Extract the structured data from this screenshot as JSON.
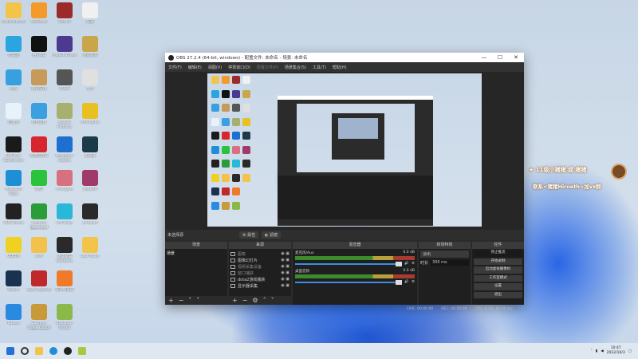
{
  "desktop_icons": [
    {
      "label": "Administrator",
      "color": "#f2c54a"
    },
    {
      "label": "WeGame",
      "color": "#f39a2b"
    },
    {
      "label": "Dota 2",
      "color": "#9b2a2a"
    },
    {
      "label": "设置",
      "color": "#f0f0f0"
    },
    {
      "label": "此电脑",
      "color": "#2aa5e0"
    },
    {
      "label": "腾讯QQ",
      "color": "#111111"
    },
    {
      "label": "Project Winter",
      "color": "#4b3a8f"
    },
    {
      "label": "英雄联盟",
      "color": "#c9a64a"
    },
    {
      "label": "网络",
      "color": "#39a0e0"
    },
    {
      "label": "腾讯游戏",
      "color": "#c79a5a"
    },
    {
      "label": "PUBG",
      "color": "#555555"
    },
    {
      "label": "文件",
      "color": "#e0e0e0"
    },
    {
      "label": "回收站",
      "color": "#e8f2fb"
    },
    {
      "label": "控制面板",
      "color": "#3aa0e0"
    },
    {
      "label": "Mosaic Fortress",
      "color": "#a8b070"
    },
    {
      "label": "Among Us",
      "color": "#e8c020"
    },
    {
      "label": "GeForce Experience",
      "color": "#1a1a1a"
    },
    {
      "label": "网易云音乐",
      "color": "#d8262e"
    },
    {
      "label": "Wallpaper Engine",
      "color": "#1f6fd0"
    },
    {
      "label": "加速器",
      "color": "#1b3a4a"
    },
    {
      "label": "Microsoft Edge",
      "color": "#1e8fd6"
    },
    {
      "label": "微信",
      "color": "#2bc23c"
    },
    {
      "label": "Arknights",
      "color": "#d87080"
    },
    {
      "label": "WinRAR",
      "color": "#a03a6a"
    },
    {
      "label": "OBS Studio",
      "color": "#222222"
    },
    {
      "label": "Internet Download Manager",
      "color": "#2a9c3a"
    },
    {
      "label": "Fall Guys",
      "color": "#2ab8d8"
    },
    {
      "label": "un-dead",
      "color": "#2a2a2a"
    },
    {
      "label": "QQ音乐",
      "color": "#f0d020"
    },
    {
      "label": "WPS",
      "color": "#f2c24a"
    },
    {
      "label": "英雄联盟WeGame",
      "color": "#2a2a2a"
    },
    {
      "label": "Leaf folder",
      "color": "#f2c54a"
    },
    {
      "label": "Steam",
      "color": "#1b3150"
    },
    {
      "label": "Apex Legends",
      "color": "#c0282a"
    },
    {
      "label": "雷神加速器",
      "color": "#f07a2a"
    },
    {
      "label": "",
      "color": ""
    },
    {
      "label": "ToDesk",
      "color": "#2a8ae0"
    },
    {
      "label": "Counter-Strike Global Offensive",
      "color": "#c89a3a"
    },
    {
      "label": "Emulator Studio",
      "color": "#8ab84a"
    },
    {
      "label": "",
      "color": ""
    }
  ],
  "obs": {
    "title": "OBS 27.2.4 (64-bit, windows) - 配置文件: 未命名 - 场景: 未命名",
    "window_buttons": [
      "—",
      "☐",
      "✕"
    ],
    "menu": [
      "文件(F)",
      "编辑(E)",
      "视图(V)",
      "停靠窗口(D)",
      "配置文件(P)",
      "场景集合(S)",
      "工具(T)",
      "帮助(H)"
    ],
    "no_source": "未选择源",
    "properties": "⚙ 属性",
    "filters": "◐ 滤镜",
    "docks": {
      "scenes": "场景",
      "sources": "来源",
      "mixer": "混音器",
      "transitions": "转场特效",
      "controls": "控件"
    },
    "scene_items": [
      "场景"
    ],
    "sources": [
      "图像",
      "图像幻灯片",
      "视频采集设备",
      "窗口捕获",
      "dota2游戏捕获",
      "显示器采集"
    ],
    "mixer": [
      {
        "name": "麦克风/Aux",
        "db": "0.0 dB",
        "level": 1.0
      },
      {
        "name": "桌面音频",
        "db": "0.0 dB",
        "level": 1.0
      }
    ],
    "transition": {
      "type": "淡出",
      "duration_label": "时长",
      "duration": "300 ms"
    },
    "controls": [
      "停止推流",
      "开始录制",
      "启动虚拟摄像机",
      "工作室模式",
      "设置",
      "退出"
    ],
    "status": {
      "live": "LIVE: 00:00:00",
      "rec": "REC: 00:00:00",
      "cpu": "CPU: 0.4%, 60.00 fps"
    }
  },
  "overlay": {
    "line1": "★ 11级小猪猪 或 猪猪",
    "line2": "联系<猪猪Hiroeth>加vx群"
  },
  "taskbar": {
    "time": "10:47",
    "date": "2022/10/3"
  }
}
